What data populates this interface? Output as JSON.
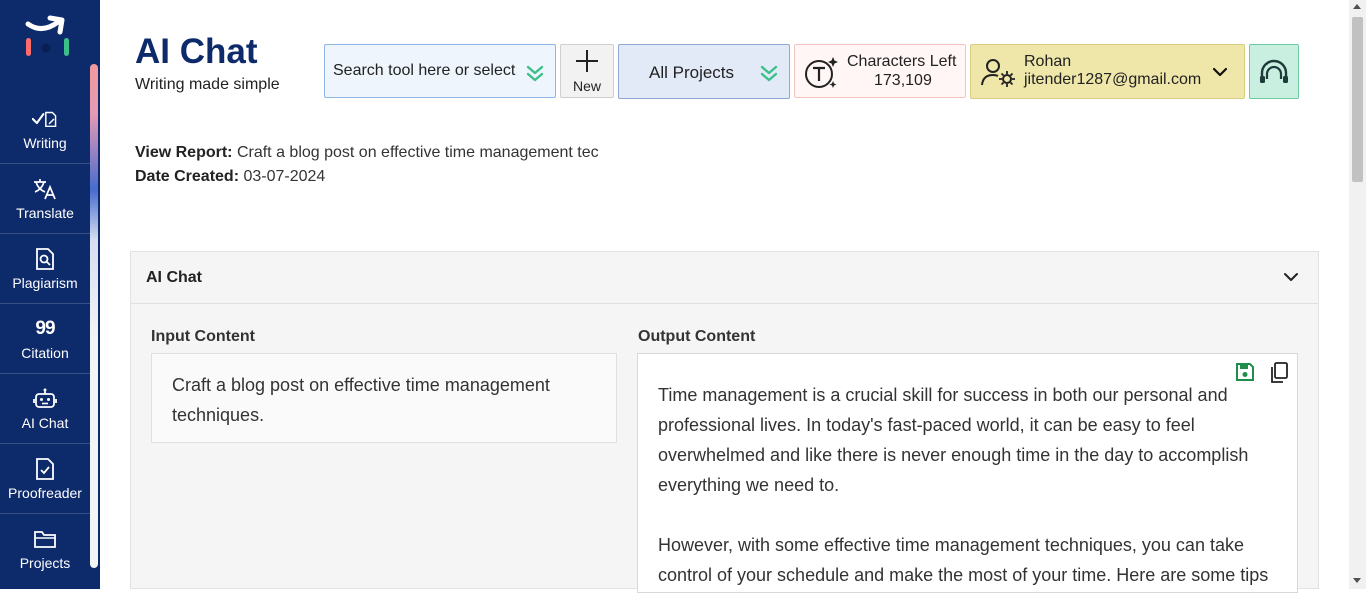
{
  "app": {
    "title": "AI Chat",
    "subtitle": "Writing made simple"
  },
  "sidebar": {
    "items": [
      {
        "label": "Writing",
        "icon": "writing-icon"
      },
      {
        "label": "Translate",
        "icon": "translate-icon"
      },
      {
        "label": "Plagiarism",
        "icon": "plagiarism-icon"
      },
      {
        "label": "Citation",
        "icon": "quote-icon",
        "glyph": "99"
      },
      {
        "label": "AI Chat",
        "icon": "robot-icon"
      },
      {
        "label": "Proofreader",
        "icon": "proofreader-icon"
      },
      {
        "label": "Projects",
        "icon": "folder-icon"
      }
    ],
    "active": "Writing"
  },
  "header": {
    "search_placeholder": "Search tool here or select",
    "new_label": "New",
    "projects_label": "All Projects",
    "characters_label": "Characters Left",
    "characters_value": "173,109",
    "user_name": "Rohan",
    "user_email": "jitender1287@gmail.com"
  },
  "report": {
    "view_label": "View Report:",
    "view_value": "Craft a blog post on effective time management tec",
    "date_label": "Date Created:",
    "date_value": "03-07-2024"
  },
  "panel": {
    "title": "AI Chat",
    "input_label": "Input Content",
    "input_text": "Craft a blog post on effective time management techniques.",
    "output_label": "Output Content",
    "output_paragraphs": [
      "Time management is a crucial skill for success in both our personal and professional lives. In today's fast-paced world, it can be easy to feel overwhelmed and like there is never enough time in the day to accomplish everything we need to.",
      "However, with some effective time management techniques, you can take control of your schedule and make the most of your time. Here are some tips"
    ]
  },
  "colors": {
    "sidebar_bg": "#0d2a6b",
    "title": "#0d2a6b",
    "accent_green": "#3cc08a",
    "save_icon": "#1e8e4a"
  }
}
